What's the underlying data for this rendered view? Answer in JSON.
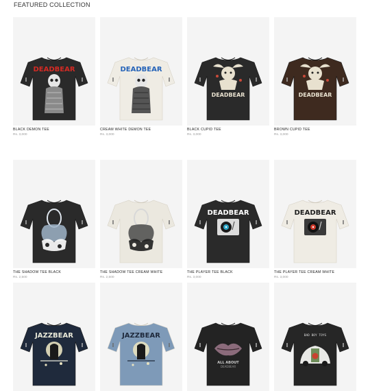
{
  "section": {
    "title": "FEATURED COLLECTION"
  },
  "products": [
    {
      "name": "BLACK DEMON TEE",
      "price": "Rs. 3,000",
      "shirt": "#2a2a2a",
      "art": "demon",
      "brand_color": "#d42a24",
      "icon": "demon-tee-icon"
    },
    {
      "name": "CREAM WHITE DEMON TEE",
      "price": "Rs. 3,000",
      "shirt": "#efece4",
      "art": "demon",
      "brand_color": "#2563b8",
      "icon": "demon-tee-icon"
    },
    {
      "name": "BLACK CUPID TEE",
      "price": "Rs. 3,000",
      "shirt": "#2a2a2a",
      "art": "cupid",
      "brand_color": "#e8e1cf",
      "icon": "cupid-tee-icon"
    },
    {
      "name": "BROWN CUPID TEE",
      "price": "Rs. 3,000",
      "shirt": "#3e2a1f",
      "art": "cupid",
      "brand_color": "#e8e1cf",
      "icon": "cupid-tee-icon"
    },
    {
      "name": "THE SHADOW TEE BLACK",
      "price": "Rs. 2,500",
      "shirt": "#2a2a2a",
      "art": "shadow",
      "brand_color": "#dfe6ee",
      "icon": "shadow-tee-icon"
    },
    {
      "name": "THE SHADOW TEE CREAM WHITE",
      "price": "Rs. 2,500",
      "shirt": "#ebe8df",
      "art": "shadow",
      "brand_color": "#d8d8d8",
      "icon": "shadow-tee-icon"
    },
    {
      "name": "THE PLAYER TEE BLACK",
      "price": "Rs. 3,000",
      "shirt": "#2a2a2a",
      "art": "player",
      "brand_color": "#ffffff",
      "icon": "turntable-tee-icon"
    },
    {
      "name": "THE PLAYER TEE CREAM WHITE",
      "price": "Rs. 3,000",
      "shirt": "#efece4",
      "art": "player",
      "brand_color": "#1f1f1f",
      "icon": "turntable-tee-icon"
    },
    {
      "name": "",
      "price": "",
      "shirt": "#1f2a3c",
      "art": "jazz",
      "brand_color": "#e8e8d8",
      "icon": "jazz-bear-tee-icon"
    },
    {
      "name": "",
      "price": "",
      "shirt": "#7e9ab8",
      "art": "jazz",
      "brand_color": "#1f2a3c",
      "icon": "jazz-bear-tee-icon"
    },
    {
      "name": "",
      "price": "",
      "shirt": "#232323",
      "art": "lips",
      "brand_color": "#cfcfcf",
      "icon": "lips-tee-icon"
    },
    {
      "name": "",
      "price": "",
      "shirt": "#262626",
      "art": "car",
      "brand_color": "#dddddd",
      "icon": "car-tee-icon"
    }
  ]
}
